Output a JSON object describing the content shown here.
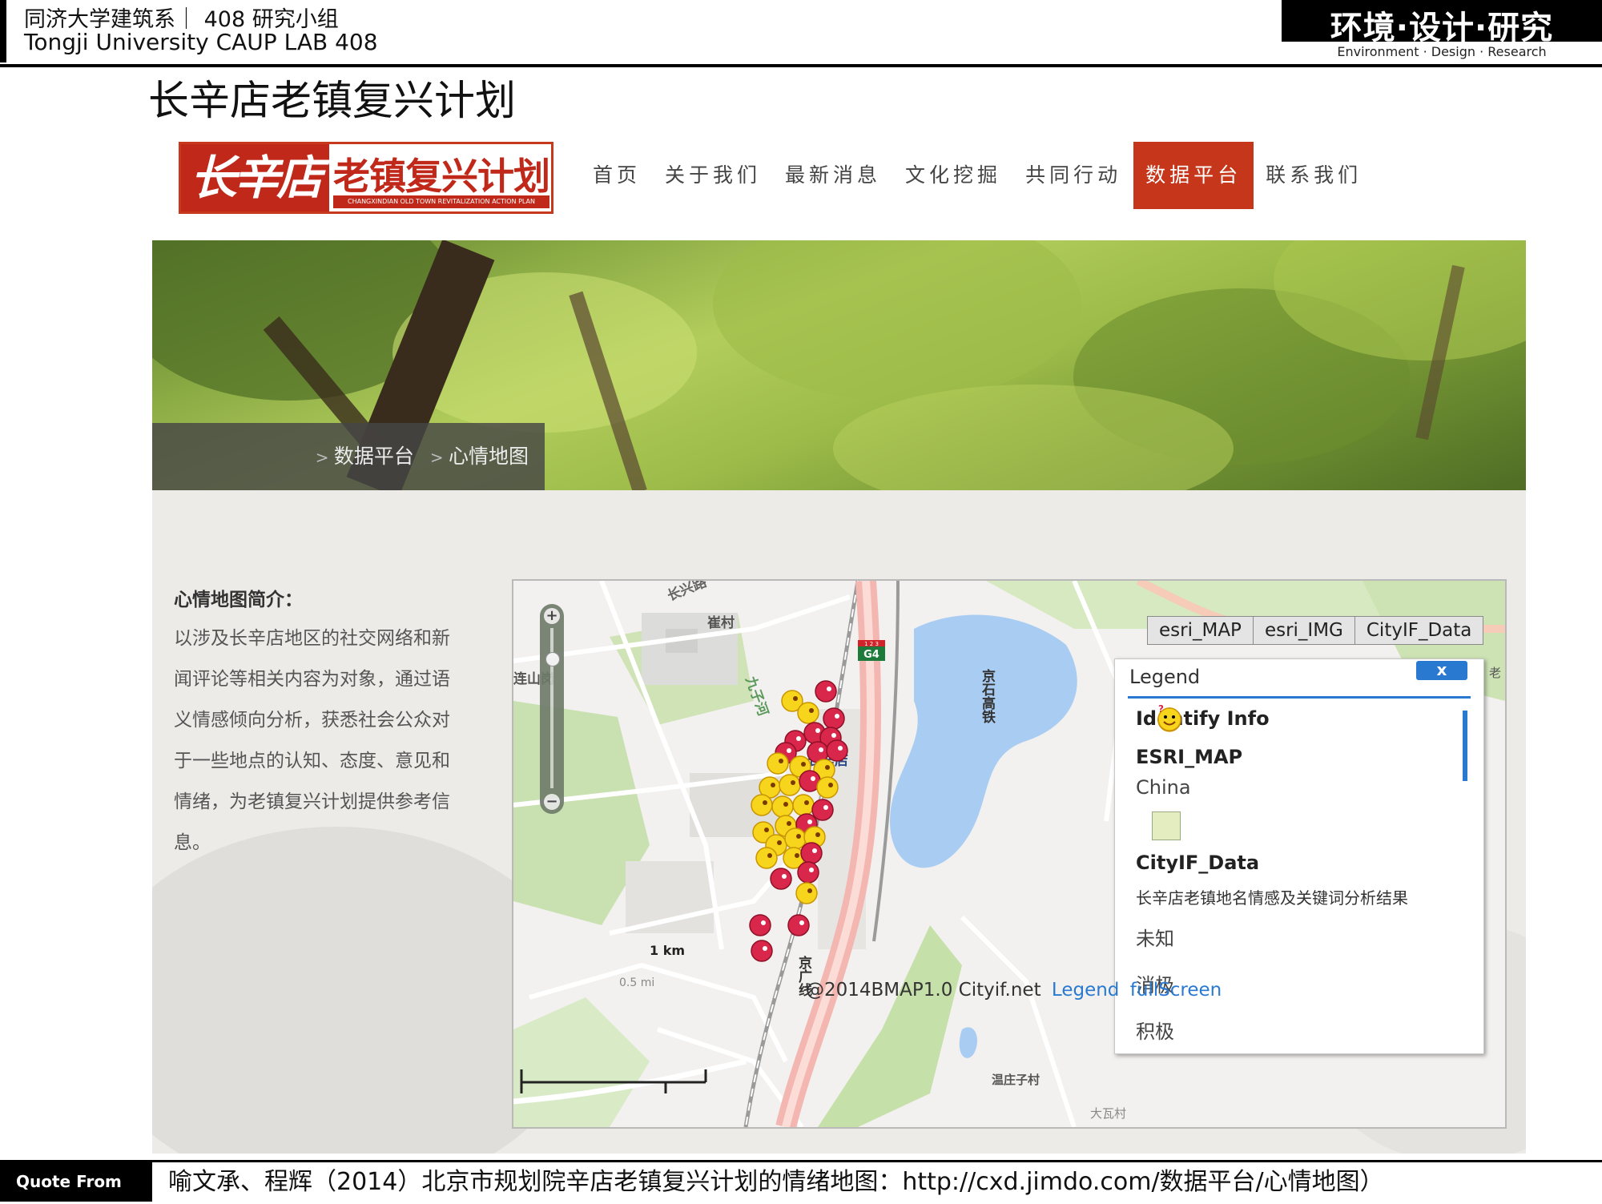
{
  "slide": {
    "org_line1": "同济大学建筑系｜ 408 研究小组",
    "org_line2": "Tongji University CAUP  LAB 408",
    "brand_main": "环境·设计·研究",
    "brand_sub": "Environment · Design · Research",
    "title": "长辛店老镇复兴计划"
  },
  "site": {
    "logo_red": "长辛店",
    "logo_main": "老镇复兴计划",
    "logo_sub": "CHANGXINDIAN OLD TOWN REVITALIZATION ACTION PLAN",
    "nav": [
      {
        "label": "首页",
        "active": false
      },
      {
        "label": "关于我们",
        "active": false
      },
      {
        "label": "最新消息",
        "active": false
      },
      {
        "label": "文化挖掘",
        "active": false
      },
      {
        "label": "共同行动",
        "active": false
      },
      {
        "label": "数据平台",
        "active": true
      },
      {
        "label": "联系我们",
        "active": false
      }
    ],
    "breadcrumb": [
      "数据平台",
      "心情地图"
    ],
    "intro_title": "心情地图简介：",
    "intro_body": "以涉及长辛店地区的社交网络和新闻评论等相关内容为对象，通过语义情感倾向分析，获悉社会公众对于一些地点的认知、态度、意见和情绪，为老镇复兴计划提供参考信息。"
  },
  "map": {
    "basemaps": [
      "esri_MAP",
      "esri_IMG",
      "CityIF_Data"
    ],
    "zoom_in": "+",
    "zoom_out": "−",
    "labels": {
      "changxin_road": "长兴路",
      "cuicun": "崔村",
      "lianshan": "连山岗",
      "jiuzi_river": "九子河",
      "changxindian": "长辛店",
      "jingshi_rail": "京石高铁",
      "jingguang_line": "京广线",
      "wenzhuangzi": "温庄子村",
      "dawacun": "大瓦村",
      "edge_lao": "老",
      "g4_top": "1 2 3",
      "g4": "G4"
    },
    "legend": {
      "title": "Legend",
      "close": "x",
      "identify": "Identify Info",
      "esri_map": "ESRI_MAP",
      "china": "China",
      "cityif": "CityIF_Data",
      "layer_name": "长辛店老镇地名情感及关键词分析结果",
      "items": [
        {
          "label": "未知",
          "icon": "unknown-emoji-icon",
          "color": "#f7cc1c"
        },
        {
          "label": "消极",
          "icon": "negative-emoji-icon",
          "color": "#d8274a"
        },
        {
          "label": "积极",
          "icon": "positive-emoji-icon",
          "color": "#f7d51c"
        }
      ]
    },
    "scale_km": "1 km",
    "scale_mi": "0.5 mi",
    "attribution": "@2014BMAP1.0 Cityif.net",
    "link_legend": "Legend",
    "link_fullscreen": "fullScreen"
  },
  "footer": {
    "quote_label": "Quote From",
    "quote_text": "喻文承、程辉（2014）北京市规划院辛店老镇复兴计划的情绪地图：http://cxd.jimdo.com/数据平台/心情地图）"
  },
  "colors": {
    "accent_red": "#c5361a",
    "legend_blue": "#2979d1",
    "negative": "#d8274a",
    "positive": "#f7d51c"
  }
}
